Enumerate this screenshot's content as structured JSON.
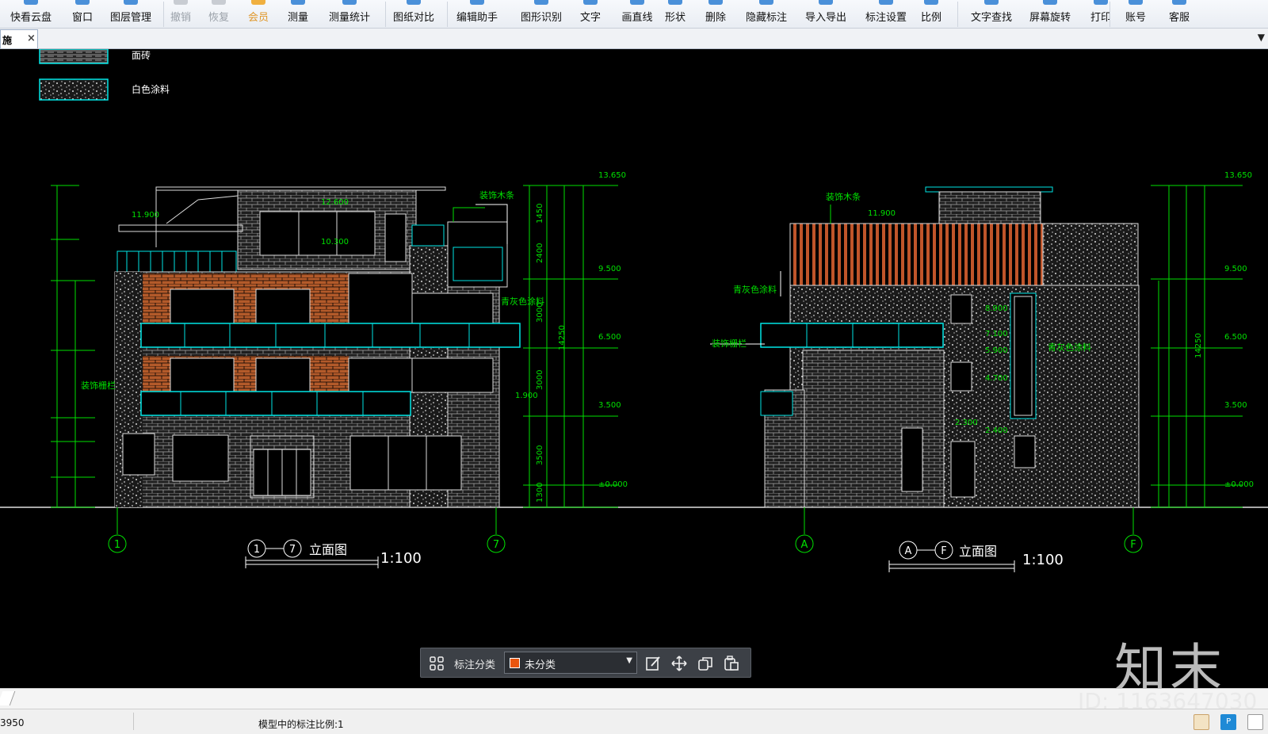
{
  "toolbar": {
    "items": [
      {
        "label": "快看云盘",
        "icon": "cloud-icon",
        "state": "normal"
      },
      {
        "label": "窗口",
        "icon": "window-icon",
        "state": "normal"
      },
      {
        "label": "图层管理",
        "icon": "layers-icon",
        "state": "normal"
      },
      {
        "label": "撤销",
        "icon": "undo-icon",
        "state": "disabled"
      },
      {
        "label": "恢复",
        "icon": "redo-icon",
        "state": "disabled"
      },
      {
        "label": "会员",
        "icon": "vip-icon",
        "state": "vip"
      },
      {
        "label": "测量",
        "icon": "ruler-icon",
        "state": "normal"
      },
      {
        "label": "测量统计",
        "icon": "measure-stats-icon",
        "state": "normal"
      },
      {
        "label": "图纸对比",
        "icon": "compare-icon",
        "state": "normal"
      },
      {
        "label": "编辑助手",
        "icon": "edit-assistant-icon",
        "state": "normal"
      },
      {
        "label": "图形识别",
        "icon": "shape-recognize-icon",
        "state": "normal"
      },
      {
        "label": "文字",
        "icon": "text-icon",
        "state": "normal"
      },
      {
        "label": "画直线",
        "icon": "line-icon",
        "state": "normal"
      },
      {
        "label": "形状",
        "icon": "shape-icon",
        "state": "normal"
      },
      {
        "label": "删除",
        "icon": "delete-icon",
        "state": "normal"
      },
      {
        "label": "隐藏标注",
        "icon": "hide-annotation-icon",
        "state": "normal"
      },
      {
        "label": "导入导出",
        "icon": "import-export-icon",
        "state": "normal"
      },
      {
        "label": "标注设置",
        "icon": "annotation-settings-icon",
        "state": "normal"
      },
      {
        "label": "比例",
        "icon": "scale-icon",
        "state": "normal"
      },
      {
        "label": "文字查找",
        "icon": "text-search-icon",
        "state": "normal"
      },
      {
        "label": "屏幕旋转",
        "icon": "rotate-screen-icon",
        "state": "normal"
      },
      {
        "label": "打印",
        "icon": "print-icon",
        "state": "normal"
      },
      {
        "label": "账号",
        "icon": "account-icon",
        "state": "normal"
      },
      {
        "label": "客服",
        "icon": "support-icon",
        "state": "normal"
      }
    ]
  },
  "tabbar": {
    "tab_label": "施",
    "close_glyph": "×",
    "menu_glyph": "▼"
  },
  "drawing": {
    "legend": [
      {
        "label": "面砖"
      },
      {
        "label": "白色涂料"
      }
    ],
    "left_elevation": {
      "title_axes": [
        "1",
        "7"
      ],
      "title_text": "立面图",
      "scale": "1:100",
      "axis_bubbles": [
        "1",
        "7"
      ],
      "elevations": [
        "13.650",
        "9.500",
        "6.500",
        "3.500",
        "±0.000"
      ],
      "total_height": "14250",
      "notes": [
        "装饰木条",
        "青灰色涂料",
        "装饰栅栏",
        "11.900",
        "12.600",
        "10.300",
        "1.900"
      ],
      "floor_dims": [
        "1450",
        "2400",
        "3000",
        "3000",
        "3500",
        "1300"
      ]
    },
    "right_elevation": {
      "title_axes": [
        "A",
        "F"
      ],
      "title_text": "立面图",
      "scale": "1:100",
      "axis_bubbles": [
        "A",
        "F"
      ],
      "elevations": [
        "13.650",
        "9.500",
        "6.500",
        "3.500",
        "±0.000"
      ],
      "total_height": "14250",
      "notes": [
        "装饰木条",
        "青灰色涂料",
        "装饰栅栏",
        "青灰色涂料",
        "11.900",
        "8.900",
        "7.100",
        "5.900",
        "4.700",
        "2.300",
        "2.400"
      ]
    },
    "colors": {
      "line": "#00e000",
      "cyan": "#00e5e5",
      "brick": "#b35a2a",
      "wood": "#c0552a",
      "white": "#d8d8d8",
      "text": "#ffffff"
    }
  },
  "annotation_bar": {
    "grid_icon": "grid-icon",
    "label": "标注分类",
    "category": "未分类",
    "category_color": "#e8550f",
    "actions": [
      {
        "icon": "edit-annotation-icon"
      },
      {
        "icon": "move-icon"
      },
      {
        "icon": "copy-icon"
      },
      {
        "icon": "paste-icon"
      }
    ]
  },
  "statusbar": {
    "coords": "3950",
    "scale_text": "模型中的标注比例:1",
    "icons": [
      "layer-status-icon",
      "p-mode-icon",
      "window-mode-icon"
    ]
  },
  "watermark": {
    "logo": "知末",
    "id": "ID: 1163647030"
  }
}
